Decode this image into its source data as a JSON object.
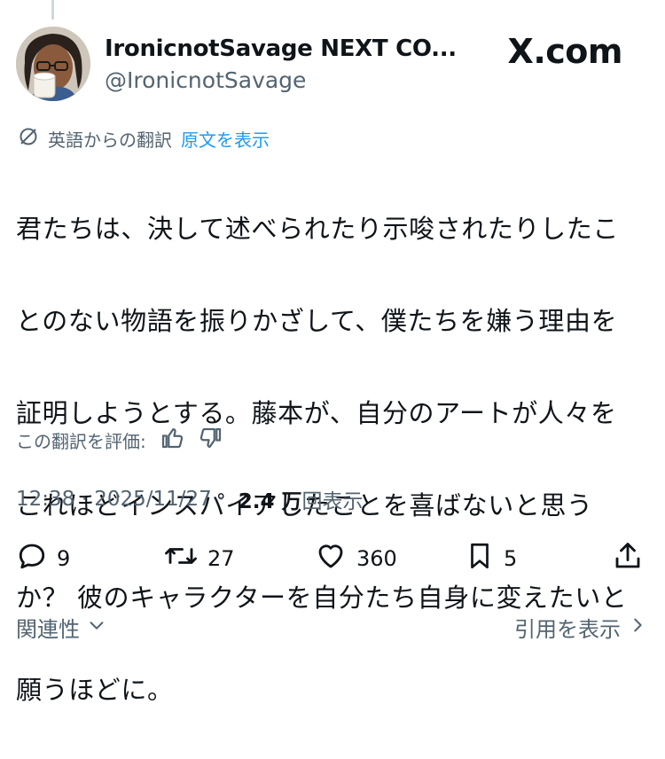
{
  "tweet": {
    "author_name": "IronicnotSavage NEXT CO...",
    "author_handle": "@IronicnotSavage",
    "source_brand": "X.com",
    "translation_label": "英語からの翻訳",
    "show_original_label": "原文を表示",
    "body_lines": [
      "君たちは、決して述べられたり示唆されたりしたこ",
      "とのない物語を振りかざして、僕たちを嫌う理由を",
      "証明しようとする。藤本が、自分のアートが人々を",
      "これほどインスパイアしたことを喜ばないと思う",
      "か？ 彼のキャラクターを自分たち自身に変えたいと",
      "願うほどに。"
    ],
    "rate_translation_label": "この翻訳を評価:",
    "time": "12:38",
    "date": "2025/11/27",
    "views_count": "2.4 万",
    "views_label": "回表示"
  },
  "actions": {
    "replies": "9",
    "reposts": "27",
    "likes": "360",
    "bookmarks": "5"
  },
  "footer": {
    "related_label": "関連性",
    "quotes_label": "引用を表示"
  },
  "colors": {
    "text": "#0f1419",
    "secondary": "#536471",
    "link": "#1d9bf0"
  }
}
